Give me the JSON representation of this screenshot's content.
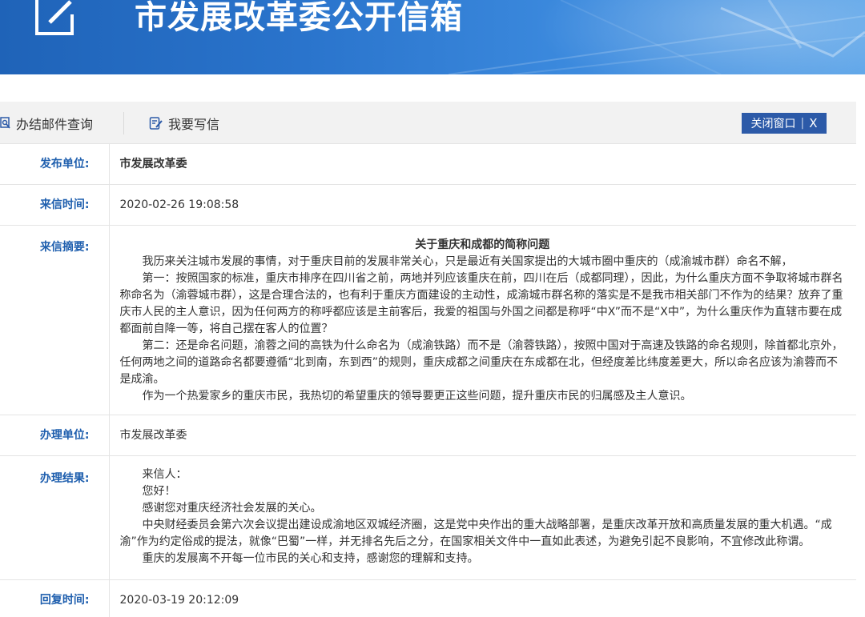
{
  "header": {
    "title": "市发展改革委公开信箱"
  },
  "toolbar": {
    "query_label": "办结邮件查询",
    "write_label": "我要写信",
    "close_label": "关闭窗口",
    "close_x": "X"
  },
  "detail": {
    "publisher": {
      "label": "发布单位:",
      "value": "市发展改革委"
    },
    "letter_time": {
      "label": "来信时间:",
      "value": "2020-02-26 19:08:58"
    },
    "summary": {
      "label": "来信摘要:",
      "title": "关于重庆和成都的简称问题",
      "paragraphs": [
        "我历来关注城市发展的事情，对于重庆目前的发展非常关心，只是最近有关国家提出的大城市圈中重庆的（成渝城市群）命名不解，",
        "第一：按照国家的标准，重庆市排序在四川省之前，两地并列应该重庆在前，四川在后（成都同理），因此，为什么重庆方面不争取将城市群名称命名为（渝蓉城市群），这是合理合法的，也有利于重庆方面建设的主动性，成渝城市群名称的落实是不是我市相关部门不作为的结果？放弃了重庆市人民的主人意识，因为任何两方的称呼都应该是主前客后，我爱的祖国与外国之间都是称呼“中X”而不是“X中”，为什么重庆作为直辖市要在成都面前自降一等，将自己摆在客人的位置？",
        "第二：还是命名问题，渝蓉之间的高铁为什么命名为（成渝铁路）而不是（渝蓉铁路），按照中国对于高速及铁路的命名规则，除首都北京外，任何两地之间的道路命名都要遵循“北到南，东到西”的规则，重庆成都之间重庆在东成都在北，但经度差比纬度差更大，所以命名应该为渝蓉而不是成渝。",
        "作为一个热爱家乡的重庆市民，我热切的希望重庆的领导要更正这些问题，提升重庆市民的归属感及主人意识。"
      ]
    },
    "handler": {
      "label": "办理单位:",
      "value": "市发展改革委"
    },
    "result": {
      "label": "办理结果:",
      "paragraphs": [
        "来信人：",
        "您好！",
        "感谢您对重庆经济社会发展的关心。",
        "中央财经委员会第六次会议提出建设成渝地区双城经济圈，这是党中央作出的重大战略部署，是重庆改革开放和高质量发展的重大机遇。“成渝”作为约定俗成的提法，就像“巴蜀”一样，并无排名先后之分，在国家相关文件中一直如此表述，为避免引起不良影响，不宜修改此称谓。",
        "重庆的发展离不开每一位市民的关心和支持，感谢您的理解和支持。"
      ]
    },
    "reply_time": {
      "label": "回复时间:",
      "value": "2020-03-19 20:12:09"
    }
  }
}
